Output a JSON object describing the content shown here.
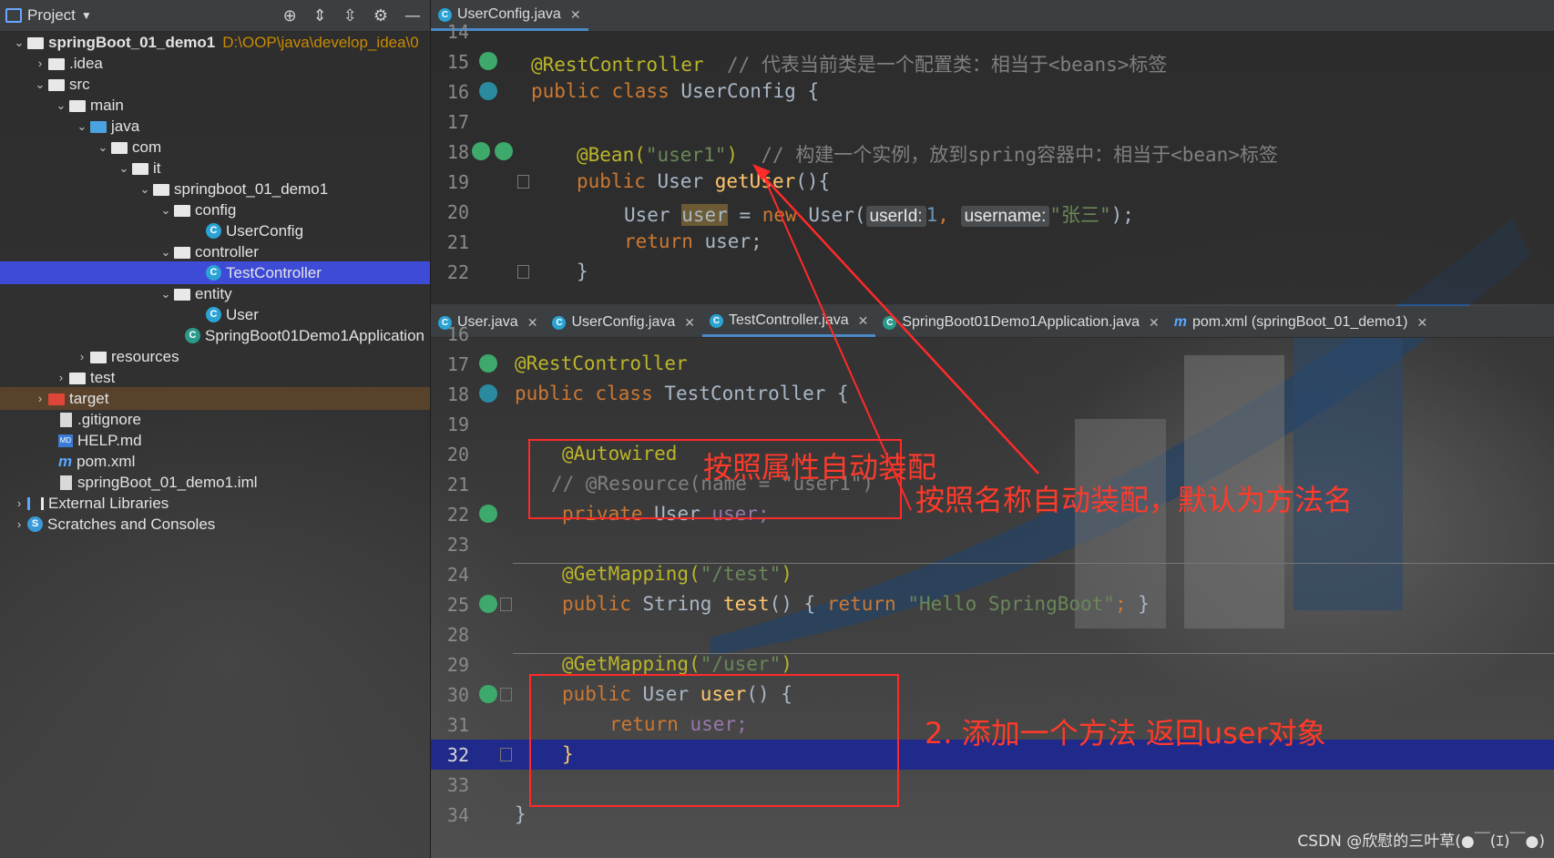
{
  "project": {
    "title": "Project",
    "rows": [
      {
        "label": "springBoot_01_demo1",
        "path": "D:\\OOP\\java\\develop_idea\\0"
      },
      {
        "label": ".idea"
      },
      {
        "label": "src"
      },
      {
        "label": "main"
      },
      {
        "label": "java"
      },
      {
        "label": "com"
      },
      {
        "label": "it"
      },
      {
        "label": "springboot_01_demo1"
      },
      {
        "label": "config"
      },
      {
        "label": "UserConfig"
      },
      {
        "label": "controller"
      },
      {
        "label": "TestController"
      },
      {
        "label": "entity"
      },
      {
        "label": "User"
      },
      {
        "label": "SpringBoot01Demo1Application"
      },
      {
        "label": "resources"
      },
      {
        "label": "test"
      },
      {
        "label": "target"
      },
      {
        "label": ".gitignore"
      },
      {
        "label": "HELP.md"
      },
      {
        "label": "pom.xml"
      },
      {
        "label": "springBoot_01_demo1.iml"
      },
      {
        "label": "External Libraries"
      },
      {
        "label": "Scratches and Consoles"
      }
    ]
  },
  "editor1": {
    "tab": "UserConfig.java",
    "lines": [
      {
        "n": "14"
      },
      {
        "n": "15",
        "t1": "@RestController",
        "t2": "  // 代表当前类是一个配置类：相当于<beans>标签"
      },
      {
        "n": "16",
        "t1": "public class ",
        "t2": "UserConfig {"
      },
      {
        "n": "17"
      },
      {
        "n": "18",
        "t1": "@Bean(",
        "t2": "\"user1\"",
        "t3": ")",
        "t4": "  // 构建一个实例，放到spring容器中：相当于<bean>标签"
      },
      {
        "n": "19",
        "t1": "public ",
        "t2": "User ",
        "t3": "getUser",
        "t4": "(){"
      },
      {
        "n": "20",
        "t1": "User ",
        "t2": "user",
        "t3": " = ",
        "t4": "new ",
        "t5": "User(",
        "h1": "userId:",
        "t6": "1",
        "t7": ", ",
        "h2": "username:",
        "t8": "\"张三\"",
        "t9": ");"
      },
      {
        "n": "21",
        "t1": "return ",
        "t2": "user;"
      },
      {
        "n": "22",
        "t1": "}"
      }
    ]
  },
  "editor2": {
    "tabs": [
      {
        "label": "User.java"
      },
      {
        "label": "UserConfig.java"
      },
      {
        "label": "TestController.java"
      },
      {
        "label": "SpringBoot01Demo1Application.java"
      },
      {
        "label": "pom.xml (springBoot_01_demo1)"
      }
    ],
    "lines": [
      {
        "n": "16"
      },
      {
        "n": "17",
        "t1": "@RestController"
      },
      {
        "n": "18",
        "t1": "public class ",
        "t2": "TestController {"
      },
      {
        "n": "19"
      },
      {
        "n": "20",
        "t1": "@Autowired"
      },
      {
        "n": "21",
        "t1": "// @Resource(name = \"user1\")"
      },
      {
        "n": "22",
        "t1": "private ",
        "t2": "User ",
        "t3": "user;"
      },
      {
        "n": "23"
      },
      {
        "n": "24",
        "t1": "@GetMapping(",
        "t2": "\"/test\"",
        "t3": ")"
      },
      {
        "n": "25",
        "t1": "public ",
        "t2": "String ",
        "t3": "test",
        "t4": "() ",
        "t5": "{ ",
        "t6": "return ",
        "t7": "\"Hello SpringBoot\"",
        "t8": "; ",
        "t9": "}"
      },
      {
        "n": "28"
      },
      {
        "n": "29",
        "t1": "@GetMapping(",
        "t2": "\"/user\"",
        "t3": ")"
      },
      {
        "n": "30",
        "t1": "public ",
        "t2": "User ",
        "t3": "user",
        "t4": "() {"
      },
      {
        "n": "31",
        "t1": "return ",
        "t2": "user;"
      },
      {
        "n": "32",
        "t1": "}"
      },
      {
        "n": "33"
      },
      {
        "n": "34",
        "t1": "}"
      }
    ]
  },
  "annotations": {
    "autowired_note": "按照属性自动装配",
    "resource_note": "按照名称自动装配，默认为方法名",
    "method_note": "2. 添加一个方法 返回user对象"
  },
  "watermark": "CSDN @欣慰的三叶草(●￣(ｴ)￣●)",
  "colors": {
    "annotation_red": "#ff2a2a",
    "selection": "#3e4bd6",
    "current_line": "#1f2a8a"
  }
}
